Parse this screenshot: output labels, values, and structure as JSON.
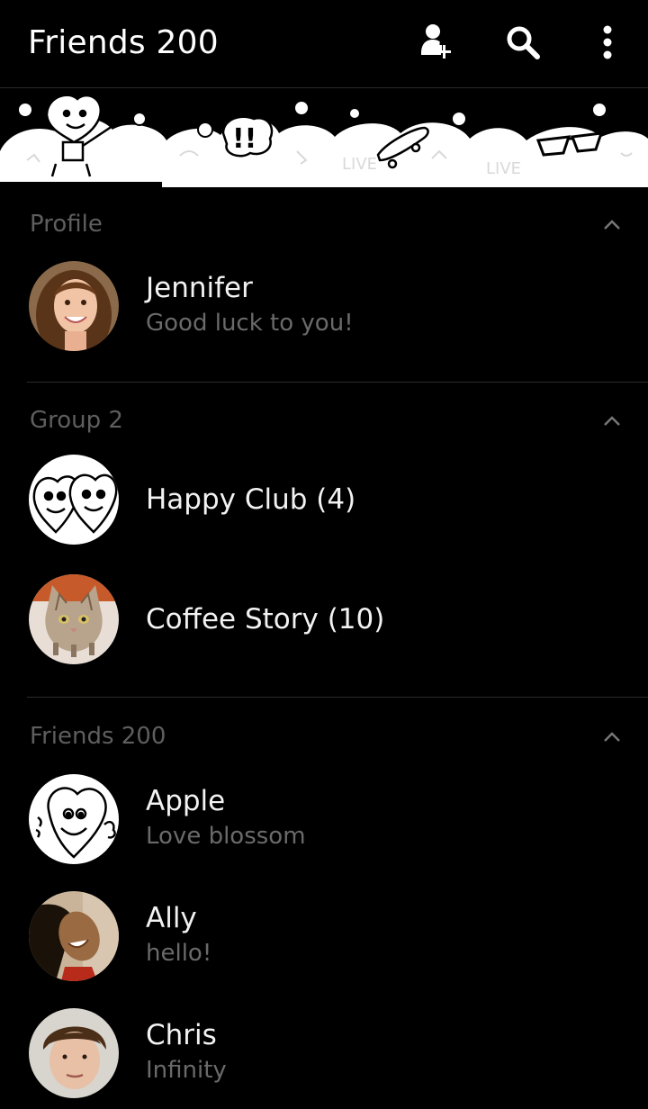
{
  "header": {
    "title": "Friends 200",
    "add_friend_icon": "add-person-icon",
    "search_icon": "search-icon",
    "more_icon": "more-vertical-icon"
  },
  "theme": {
    "background": "#000000",
    "section_title_color": "#5e5e5e",
    "subtitle_color": "#6a6a6a",
    "name_color": "#f2f2f2"
  },
  "sections": [
    {
      "title": "Profile",
      "items": [
        {
          "name": "Jennifer",
          "status": "Good luck to you!",
          "avatar": "photo-woman-smiling"
        }
      ]
    },
    {
      "title": "Group 2",
      "items": [
        {
          "name": "Happy Club (4)",
          "avatar": "cartoon-hearts"
        },
        {
          "name": "Coffee Story (10)",
          "avatar": "photo-cat"
        }
      ]
    },
    {
      "title": "Friends 200",
      "items": [
        {
          "name": "Apple",
          "status": "Love blossom",
          "avatar": "cartoon-heart-thumbs-up"
        },
        {
          "name": "Ally",
          "status": "hello!",
          "avatar": "photo-laughing-girl"
        },
        {
          "name": "Chris",
          "status": "Infinity",
          "avatar": "photo-young-man"
        }
      ]
    }
  ]
}
